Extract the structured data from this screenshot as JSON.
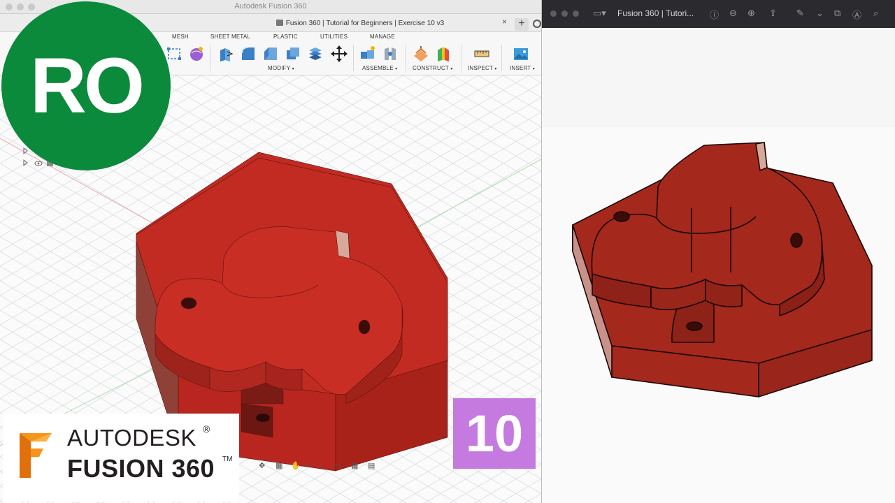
{
  "fusion": {
    "window_title": "Autodesk Fusion 360",
    "document_tab": "Fusion 360 | Tutorial for Beginners | Exercise 10 v3",
    "tab_close": "×",
    "tab_new": "+",
    "ribbon_tabs": [
      "MESH",
      "SHEET METAL",
      "PLASTIC",
      "UTILITIES",
      "MANAGE"
    ],
    "ribbon_groups": {
      "modify": "MODIFY",
      "assemble": "ASSEMBLE",
      "construct": "CONSTRUCT",
      "inspect": "INSPECT",
      "insert": "INSERT"
    },
    "caret": "▾",
    "tool_icons": [
      "sketch-rect-icon",
      "form-icon",
      "press-pull-icon",
      "fillet-icon",
      "chamfer-icon",
      "shell-icon",
      "combine-icon",
      "move-icon",
      "new-component-icon",
      "joint-icon",
      "offset-plane-icon",
      "midplane-icon",
      "measure-icon",
      "insert-image-icon"
    ]
  },
  "preview": {
    "window_title": "Fusion 360 | Tutori...",
    "toolbar_icons": [
      "sidebar-icon",
      "info-icon",
      "zoom-out-icon",
      "zoom-in-icon",
      "share-icon",
      "markup-icon",
      "rotate-icon",
      "annotate-icon",
      "search-icon"
    ]
  },
  "overlay": {
    "badge_text": "RO",
    "brand_line1": "AUTODESK",
    "brand_line2": "FUSION 360",
    "brand_registered": "®",
    "brand_trademark": "TM",
    "episode_number": "10"
  },
  "colors": {
    "model_red": "#b8261f",
    "model_side": "#8f3a32",
    "badge_green": "#0c8a3c",
    "episode_purple": "#c57ae0",
    "brand_orange": "#f7941d"
  }
}
